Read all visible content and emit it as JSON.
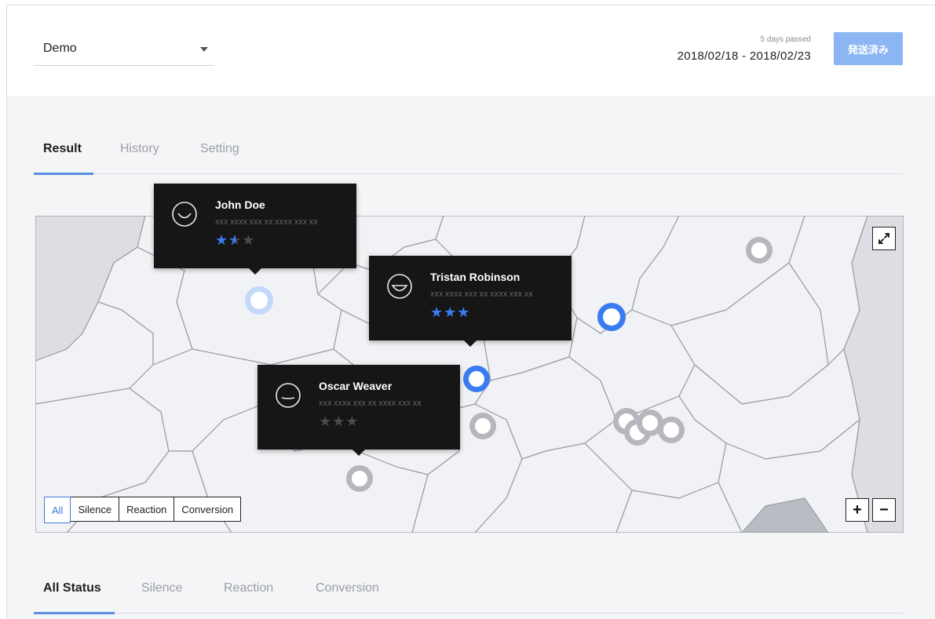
{
  "header": {
    "project_select": "Demo",
    "days_passed": "5 days passed",
    "date_range": "2018/02/18 - 2018/02/23",
    "sent_button": "発送済み"
  },
  "tabs": [
    {
      "label": "Result",
      "active": true
    },
    {
      "label": "History",
      "active": false
    },
    {
      "label": "Setting",
      "active": false
    }
  ],
  "map": {
    "filters": [
      {
        "label": "All",
        "active": true
      },
      {
        "label": "Silence",
        "active": false
      },
      {
        "label": "Reaction",
        "active": false
      },
      {
        "label": "Conversion",
        "active": false
      }
    ],
    "zoom_in": "+",
    "zoom_out": "−",
    "popups": [
      {
        "name": "John Doe",
        "subtitle": "XXX XXXX XXX XX XXXX XXX XX",
        "rating": 1.5,
        "face": "smile-face-icon"
      },
      {
        "name": "Tristan Robinson",
        "subtitle": "XXX XXXX XXX XX XXXX XXX XX",
        "rating": 3,
        "face": "grin-face-icon"
      },
      {
        "name": "Oscar Weaver",
        "subtitle": "XXX XXXX XXX XX XXXX XXX XX",
        "rating": 0,
        "face": "neutral-face-icon"
      }
    ]
  },
  "status_tabs": [
    {
      "label": "All Status",
      "active": true
    },
    {
      "label": "Silence",
      "active": false
    },
    {
      "label": "Reaction",
      "active": false
    },
    {
      "label": "Conversion",
      "active": false
    }
  ],
  "colors": {
    "accent": "#3a7cf0",
    "marker_inactive": "#b5b7bc",
    "marker_light": "#c4d8fb",
    "popup_bg": "#161616",
    "sent_button": "#8bb6f3"
  }
}
